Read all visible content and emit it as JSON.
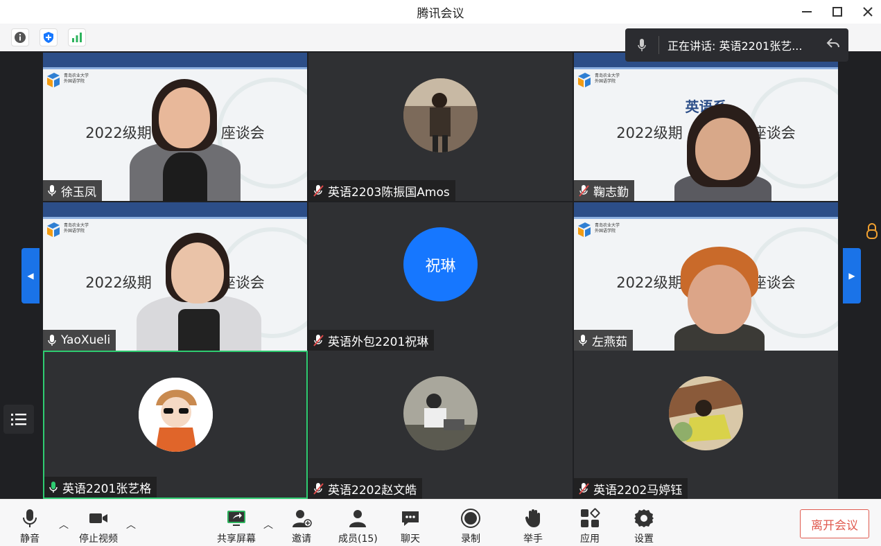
{
  "window": {
    "title": "腾讯会议"
  },
  "speaking": {
    "text": "正在讲话: 英语2201张艺..."
  },
  "slide": {
    "header": "英语系",
    "subtitle_a": "2022级期",
    "subtitle_b": "座谈会",
    "logo_line1": "青岛农业大学",
    "logo_line2": "外国语学院"
  },
  "tiles": [
    {
      "name": "徐玉凤",
      "muted": false
    },
    {
      "name": "英语2203陈振国Amos",
      "muted": true
    },
    {
      "name": "鞠志勤",
      "muted": true
    },
    {
      "name": "YaoXueli",
      "muted": false
    },
    {
      "name": "英语外包2201祝琳",
      "muted": true,
      "avatar_text": "祝琳"
    },
    {
      "name": "左燕茹",
      "muted": false
    },
    {
      "name": "英语2201张艺格",
      "muted": false,
      "active": true
    },
    {
      "name": "英语2202赵文皓",
      "muted": true
    },
    {
      "name": "英语2202马婷钰",
      "muted": true
    }
  ],
  "bottombar": {
    "mute": "静音",
    "stop_video": "停止视频",
    "share": "共享屏幕",
    "invite": "邀请",
    "members": "成员(15)",
    "chat": "聊天",
    "record": "录制",
    "raise_hand": "举手",
    "apps": "应用",
    "settings": "设置",
    "leave": "离开会议"
  },
  "colors": {
    "accent": "#1677ff",
    "active_border": "#2ecc71",
    "leave": "#e05a4f",
    "muted_icon": "#e14b4b"
  }
}
